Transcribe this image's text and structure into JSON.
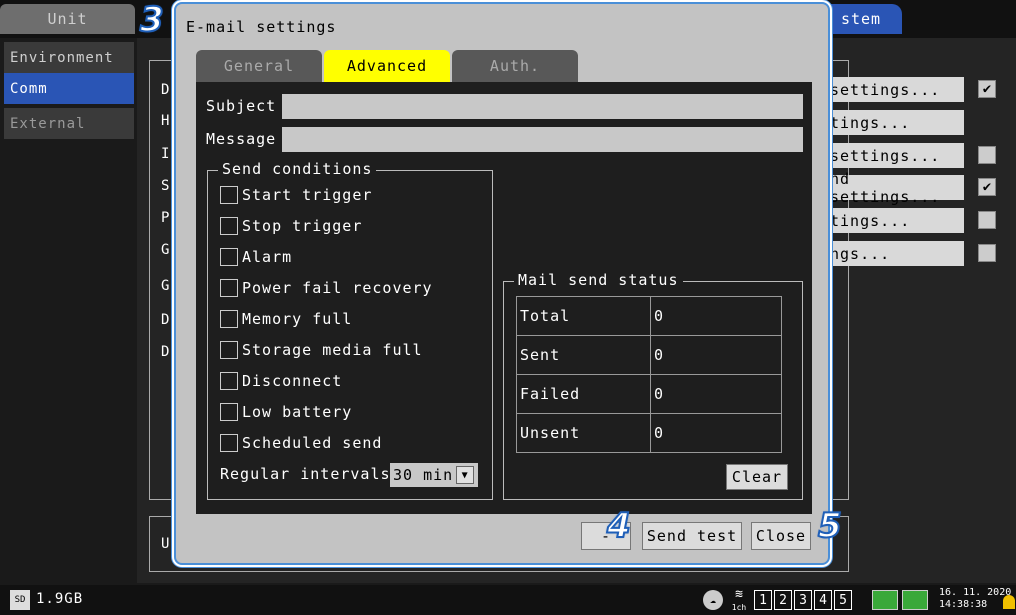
{
  "topbar": {
    "unit_tab": "Unit",
    "system_tab": "stem"
  },
  "nav": {
    "environment": "Environment",
    "comm": "Comm",
    "external": "External"
  },
  "background": {
    "letters": [
      "D",
      "H",
      "I",
      "S",
      "P",
      "G",
      "G",
      "D",
      "D"
    ],
    "settings_buttons": [
      {
        "label": "settings...",
        "checked": true
      },
      {
        "label": "tings...",
        "checked": null
      },
      {
        "label": " settings...",
        "checked": false
      },
      {
        "label": "nd settings...",
        "checked": true
      },
      {
        "label": "tings...",
        "checked": false
      },
      {
        "label": "ngs...",
        "checked": false
      }
    ],
    "lower_letter": "U"
  },
  "dialog": {
    "title": "E-mail settings",
    "tabs": {
      "general": "General",
      "advanced": "Advanced",
      "auth": "Auth."
    },
    "subject_label": "Subject",
    "subject_value": "",
    "message_label": "Message",
    "message_value": "",
    "send_conditions": {
      "title": "Send conditions",
      "items": [
        {
          "label": "Start trigger",
          "checked": false
        },
        {
          "label": "Stop trigger",
          "checked": false
        },
        {
          "label": "Alarm",
          "checked": false
        },
        {
          "label": "Power fail recovery",
          "checked": false
        },
        {
          "label": "Memory full",
          "checked": false
        },
        {
          "label": "Storage media full",
          "checked": false
        },
        {
          "label": "Disconnect",
          "checked": false
        },
        {
          "label": "Low battery",
          "checked": false
        },
        {
          "label": "Scheduled send",
          "checked": false
        }
      ],
      "regular_intervals_label": "Regular intervals",
      "regular_intervals_value": "30 min"
    },
    "mail_status": {
      "title": "Mail send status",
      "rows": [
        {
          "label": "Total",
          "value": "0"
        },
        {
          "label": "Sent",
          "value": "0"
        },
        {
          "label": "Failed",
          "value": "0"
        },
        {
          "label": "Unsent",
          "value": "0"
        }
      ],
      "clear_label": "Clear"
    },
    "hidden_button_label": "-",
    "send_test_label": "Send test",
    "close_label": "Close"
  },
  "steps": {
    "s3": "3",
    "s4": "4",
    "s5": "5"
  },
  "statusbar": {
    "storage": "1.9GB",
    "sd_label": "SD",
    "channel_label": "1ch",
    "channels": [
      "1",
      "2",
      "3",
      "4",
      "5"
    ],
    "date": "16. 11. 2020",
    "time": "14:38:38"
  },
  "colors": {
    "accent_blue": "#2a55b5",
    "tab_active": "#ffff00",
    "dialog_border": "#4a8fd8"
  }
}
